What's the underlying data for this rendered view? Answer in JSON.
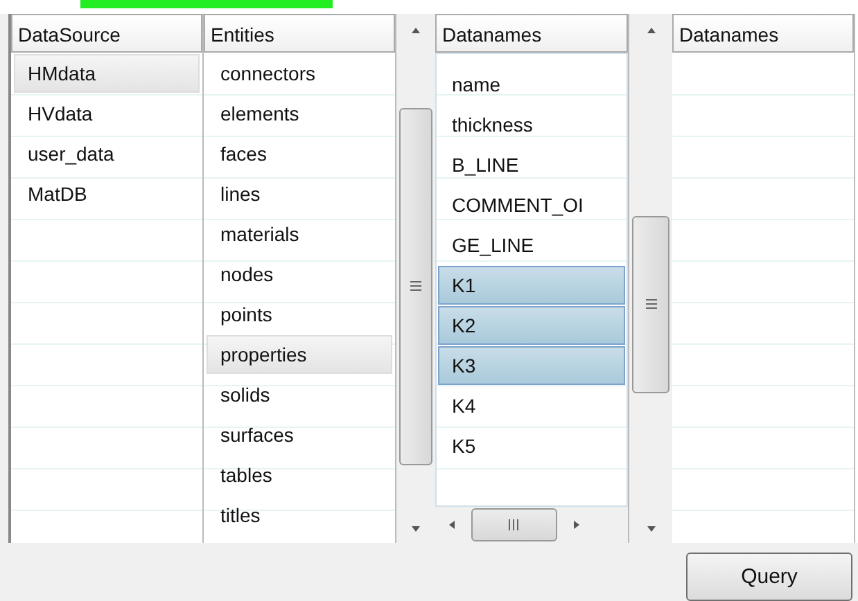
{
  "lists": [
    {
      "header": "DataSource",
      "focused": false,
      "items": [
        {
          "label": "HMdata",
          "selected": true
        },
        {
          "label": "HVdata",
          "selected": false
        },
        {
          "label": "user_data",
          "selected": false
        },
        {
          "label": "MatDB",
          "selected": false
        }
      ]
    },
    {
      "header": "Entities",
      "focused": false,
      "items": [
        {
          "label": "connectors",
          "selected": false
        },
        {
          "label": "elements",
          "selected": false
        },
        {
          "label": "faces",
          "selected": false
        },
        {
          "label": "lines",
          "selected": false
        },
        {
          "label": "materials",
          "selected": false
        },
        {
          "label": "nodes",
          "selected": false
        },
        {
          "label": "points",
          "selected": false
        },
        {
          "label": "properties",
          "selected": true
        },
        {
          "label": "solids",
          "selected": false
        },
        {
          "label": "surfaces",
          "selected": false
        },
        {
          "label": "tables",
          "selected": false
        },
        {
          "label": "titles",
          "selected": false
        }
      ]
    },
    {
      "header": "Datanames",
      "focused": true,
      "items": [
        {
          "label": "name",
          "selected": false
        },
        {
          "label": "thickness",
          "selected": false
        },
        {
          "label": "B_LINE",
          "selected": false
        },
        {
          "label": "COMMENT_OI",
          "selected": false
        },
        {
          "label": "GE_LINE",
          "selected": false
        },
        {
          "label": "K1",
          "selected": true
        },
        {
          "label": "K2",
          "selected": true
        },
        {
          "label": "K3",
          "selected": true
        },
        {
          "label": "K4",
          "selected": false
        },
        {
          "label": "K5",
          "selected": false
        }
      ]
    },
    {
      "header": "Datanames"
    }
  ],
  "query_button": "Query"
}
